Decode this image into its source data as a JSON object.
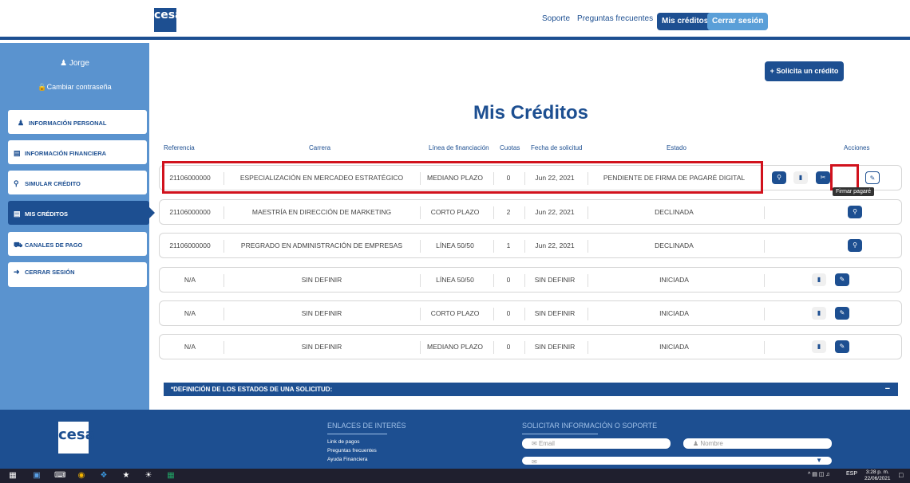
{
  "header": {
    "logo_text": "cesa",
    "nav": [
      "Soporte",
      "Preguntas frecuentes"
    ],
    "active_pill": "Mis créditos",
    "logout_pill": "Cerrar sesión"
  },
  "sidebar": {
    "user": "Jorge",
    "change_password": "Cambiar contraseña",
    "items": [
      {
        "label": "INFORMACIÓN PERSONAL",
        "icon": "user-icon"
      },
      {
        "label": "INFORMACIÓN FINANCIERA",
        "icon": "document-icon"
      },
      {
        "label": "SIMULAR CRÉDITO",
        "icon": "search-icon"
      },
      {
        "label": "MIS CRÉDITOS",
        "icon": "money-icon"
      },
      {
        "label": "CANALES DE PAGO",
        "icon": "cart-icon"
      },
      {
        "label": "CERRAR SESIÓN",
        "icon": "logout-icon"
      }
    ]
  },
  "main": {
    "new_credit_button": "+ Solicita un crédito",
    "title": "Mis Créditos",
    "columns": [
      "Referencia",
      "Carrera",
      "Línea de financiación",
      "Cuotas",
      "Fecha de solicitud",
      "Estado",
      "Acciones"
    ],
    "rows": [
      [
        "21106000000",
        "ESPECIALIZACIÓN EN MERCADEO ESTRATÉGICO",
        "MEDIANO PLAZO",
        "0",
        "Jun 22, 2021",
        "PENDIENTE DE FIRMA DE PAGARÉ DIGITAL"
      ],
      [
        "21106000000",
        "MAESTRÍA EN DIRECCIÓN DE MARKETING",
        "CORTO PLAZO",
        "2",
        "Jun 22, 2021",
        "DECLINADA"
      ],
      [
        "21106000000",
        "PREGRADO EN ADMINISTRACIÓN DE EMPRESAS",
        "LÍNEA 50/50",
        "1",
        "Jun 22, 2021",
        "DECLINADA"
      ],
      [
        "N/A",
        "SIN DEFINIR",
        "LÍNEA 50/50",
        "0",
        "SIN DEFINIR",
        "INICIADA"
      ],
      [
        "N/A",
        "SIN DEFINIR",
        "CORTO PLAZO",
        "0",
        "SIN DEFINIR",
        "INICIADA"
      ],
      [
        "N/A",
        "SIN DEFINIR",
        "MEDIANO PLAZO",
        "0",
        "SIN DEFINIR",
        "INICIADA"
      ]
    ],
    "tooltip": "Firmar pagaré",
    "definitions_bar": "*DEFINICIÓN DE LOS ESTADOS DE UNA SOLICITUD:",
    "definitions_toggle": "−"
  },
  "footer": {
    "links_heading": "ENLACES DE INTERÉS",
    "links": [
      "Link de pagos",
      "Preguntas frecuentes",
      "Ayuda Financiera"
    ],
    "support_heading": "SOLICITAR INFORMACIÓN O SOPORTE",
    "email_placeholder": "Email",
    "name_placeholder": "Nombre"
  },
  "taskbar": {
    "lang": "ESP",
    "time": "3:28 p. m.",
    "date": "22/06/2021"
  },
  "colors": {
    "brand": "#1d4f91",
    "sidebar": "#5a93cf",
    "highlight": "#d1121d"
  }
}
